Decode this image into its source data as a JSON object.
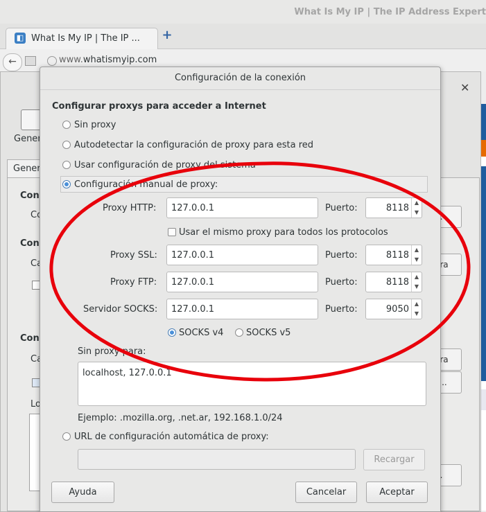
{
  "browser": {
    "window_title": "What Is My IP | The IP Address Expert",
    "tab_label": "What Is My IP | The IP ...",
    "url_prefix": "www.",
    "url_domain": "whatismyip.com"
  },
  "prefs": {
    "partial_texts": [
      "Gener",
      "Gener",
      "Con",
      "Co",
      "Con",
      "Ca",
      "Con",
      "Ca",
      "Lo"
    ],
    "partial_buttons": [
      "...",
      "ora",
      "ora",
      "s...",
      "..."
    ]
  },
  "dialog": {
    "title": "Configuración de la conexión",
    "section_heading": "Configurar proxys para acceder a Internet",
    "options": {
      "no_proxy": "Sin proxy",
      "autodetect": "Autodetectar la configuración de proxy para esta red",
      "system": "Usar configuración de proxy del sistema",
      "manual": "Configuración manual de proxy:",
      "auto_url": "URL de configuración automática de proxy:"
    },
    "selected_option": "manual",
    "http": {
      "label": "Proxy HTTP:",
      "host": "127.0.0.1",
      "port_label": "Puerto:",
      "port": "8118"
    },
    "same_proxy_label": "Usar el mismo proxy para todos los protocolos",
    "same_proxy_checked": false,
    "ssl": {
      "label": "Proxy SSL:",
      "host": "127.0.0.1",
      "port_label": "Puerto:",
      "port": "8118"
    },
    "ftp": {
      "label": "Proxy FTP:",
      "host": "127.0.0.1",
      "port_label": "Puerto:",
      "port": "8118"
    },
    "socks": {
      "label": "Servidor SOCKS:",
      "host": "127.0.0.1",
      "port_label": "Puerto:",
      "port": "9050"
    },
    "socks_v4": "SOCKS v4",
    "socks_v5": "SOCKS v5",
    "socks_selected": "v4",
    "no_proxy_for_label": "Sin proxy para:",
    "no_proxy_for_value": "localhost, 127.0.0.1",
    "example": "Ejemplo: .mozilla.org, .net.ar, 192.168.1.0/24",
    "auto_url_value": "",
    "reload_button": "Recargar",
    "help_button": "Ayuda",
    "cancel_button": "Cancelar",
    "accept_button": "Aceptar"
  },
  "annotation_color": "#e8000b"
}
